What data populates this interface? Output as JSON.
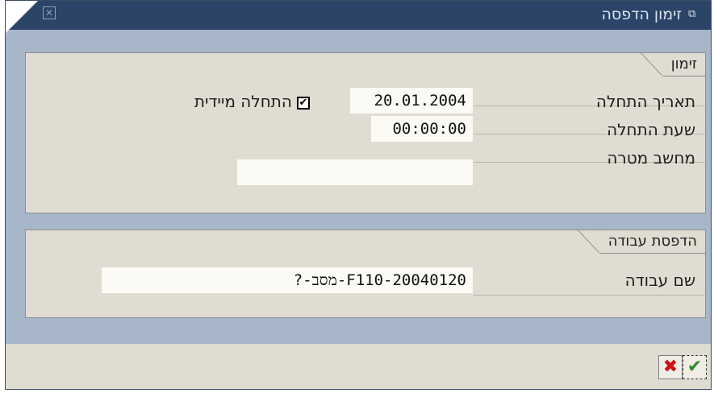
{
  "window": {
    "title": "זימון הדפסה",
    "title_icon": "print-dialog-icon",
    "close_icon": "close-icon"
  },
  "schedule": {
    "title": "זימון",
    "start_date_label": "תאריך התחלה",
    "start_date_value": "20.01.2004",
    "immediate_label": "התחלה מיידית",
    "immediate_checked": true,
    "start_time_label": "שעת התחלה",
    "start_time_value": "00:00:00",
    "target_label": "מחשב מטרה",
    "target_value": ""
  },
  "job": {
    "title": "הדפסת עבודה",
    "name_label": "שם עבודה",
    "name_value": "?-מסב-F110-20040120"
  },
  "toolbar": {
    "cancel_icon": "cancel-x-icon",
    "ok_icon": "checkmark-icon",
    "cancel_color": "#cc1111",
    "ok_color": "#2e8b2e"
  }
}
